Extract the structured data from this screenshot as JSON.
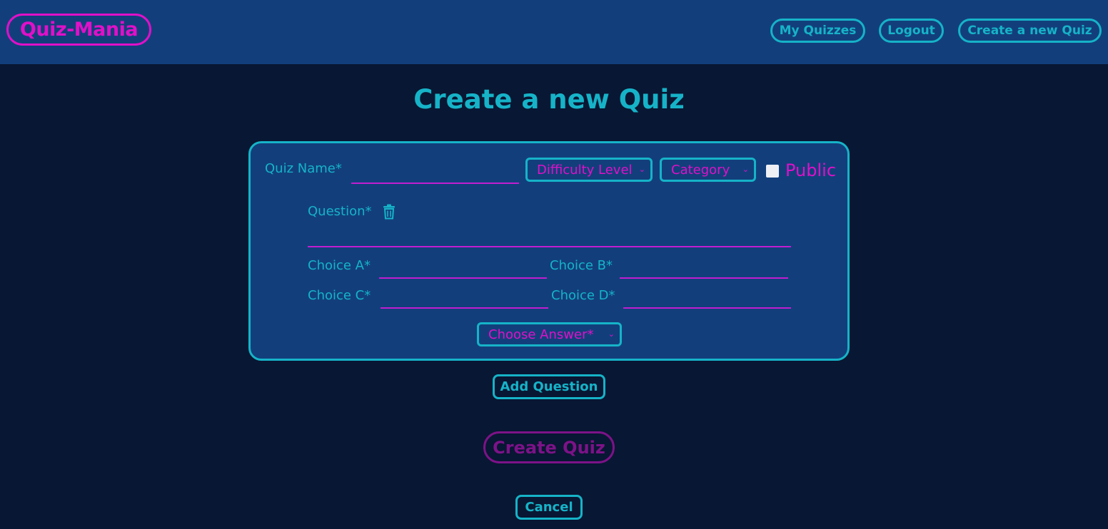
{
  "navbar": {
    "logo": "Quiz-Mania",
    "links": [
      "My Quizzes",
      "Logout",
      "Create a new Quiz"
    ]
  },
  "page": {
    "title": "Create a new Quiz"
  },
  "form": {
    "quiz_name_label": "Quiz Name*",
    "quiz_name_value": "",
    "difficulty_select": "Difficulty Level",
    "category_select": "Category",
    "public_label": "Public",
    "public_checked": false,
    "question_label": "Question*",
    "question_value": "",
    "choice_a_label": "Choice A*",
    "choice_b_label": "Choice B*",
    "choice_c_label": "Choice C*",
    "choice_d_label": "Choice D*",
    "answer_select": "Choose Answer*"
  },
  "actions": {
    "add_question": "Add Question",
    "create_quiz": "Create Quiz",
    "cancel": "Cancel"
  },
  "colors": {
    "background": "#081733",
    "panel": "#123f7c",
    "accent_cyan": "#16b3c8",
    "accent_magenta": "#e010c8",
    "disabled_purple": "#7d1288"
  },
  "icons": {
    "delete_question": "trash-icon",
    "select_arrow": "chevron-down-icon"
  }
}
